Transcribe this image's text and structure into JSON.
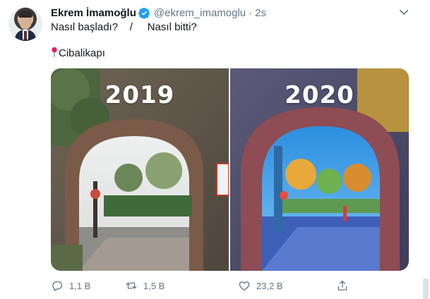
{
  "tweet": {
    "display_name": "Ekrem İmamoğlu",
    "handle": "@ekrem_imamoglu",
    "separator": "·",
    "time": "2s",
    "text_line1": "Nasıl başladı?    /     Nasıl bitti?",
    "location_text": "Cibalikapı",
    "media": {
      "left_year": "2019",
      "right_year": "2020"
    }
  },
  "actions": {
    "reply_count": "1,1 B",
    "retweet_count": "1,5 B",
    "like_count": "23,2 B"
  },
  "colors": {
    "verified": "#1da1f2",
    "secondary_text": "#657786",
    "pin": "#e0245e"
  },
  "icons": [
    "verified-badge-icon",
    "chevron-down-icon",
    "pin-icon",
    "reply-icon",
    "retweet-icon",
    "like-icon",
    "share-icon"
  ]
}
